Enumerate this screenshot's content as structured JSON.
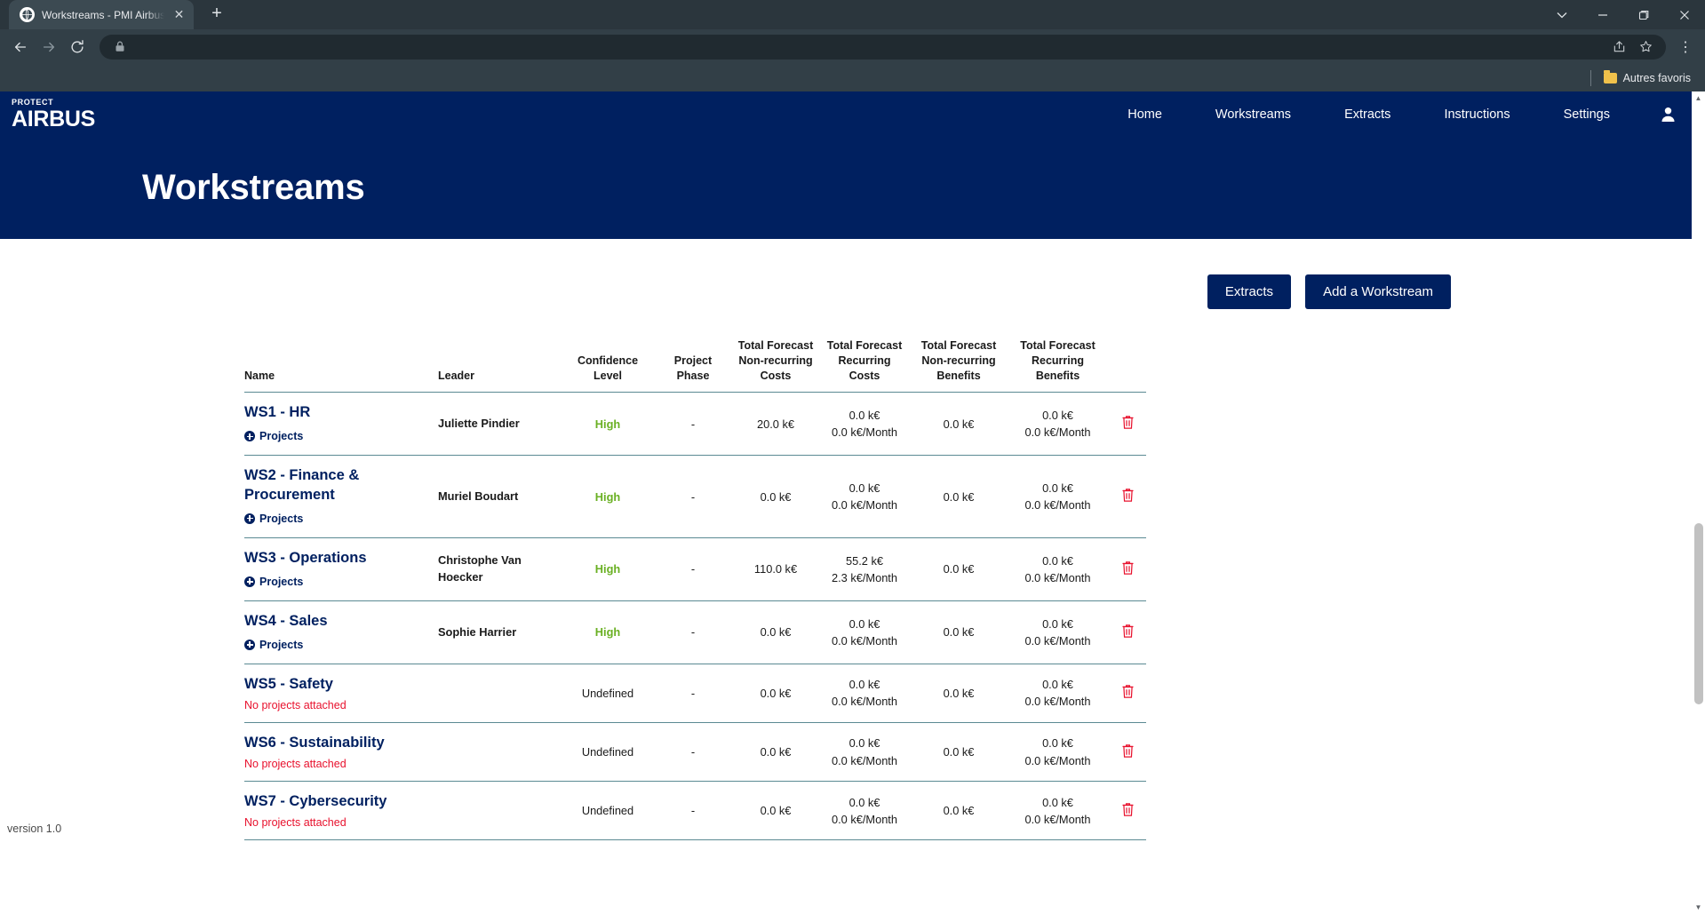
{
  "browser": {
    "tab": {
      "title": "Workstreams - PMI Airbus Protect",
      "favicon": "globe-icon",
      "close": "✕"
    },
    "new_tab_label": "+",
    "window_controls": {
      "minimize": "—",
      "maximize": "❐",
      "close": "✕",
      "tab_search": "⌄"
    },
    "nav": {
      "back": "←",
      "forward": "→",
      "reload": "⟳"
    },
    "omnibox": {
      "value": "",
      "placeholder": "",
      "lock_icon": "lock-icon",
      "share_icon": "share-icon",
      "star_icon": "star-icon"
    },
    "menu": "⋮",
    "bookmarks": [
      {
        "label": "Autres favoris",
        "icon": "folder-icon"
      }
    ]
  },
  "app": {
    "logo": {
      "top": "PROTECT",
      "bottom": "AIRBUS"
    },
    "nav_links": [
      {
        "label": "Home"
      },
      {
        "label": "Workstreams"
      },
      {
        "label": "Extracts"
      },
      {
        "label": "Instructions"
      },
      {
        "label": "Settings"
      }
    ],
    "user_icon": "user-avatar-icon",
    "page_title": "Workstreams",
    "buttons": {
      "extracts": "Extracts",
      "add_workstream": "Add a Workstream"
    },
    "footer": {
      "version": "version 1.0"
    },
    "colors": {
      "brand_navy": "#002060",
      "confidence_high": "#6ab023",
      "danger_red": "#e8112d",
      "table_border": "#5b8a93"
    }
  },
  "table": {
    "headers": {
      "name": "Name",
      "leader": "Leader",
      "confidence_level": "Confidence\nLevel",
      "confidence_level_l1": "Confidence",
      "confidence_level_l2": "Level",
      "project_phase_l1": "Project",
      "project_phase_l2": "Phase",
      "tf_nrc_l1": "Total Forecast",
      "tf_nrc_l2": "Non-recurring",
      "tf_nrc_l3": "Costs",
      "tf_rc_l1": "Total Forecast",
      "tf_rc_l2": "Recurring",
      "tf_rc_l3": "Costs",
      "tf_nrb_l1": "Total Forecast",
      "tf_nrb_l2": "Non-recurring",
      "tf_nrb_l3": "Benefits",
      "tf_rb_l1": "Total Forecast",
      "tf_rb_l2": "Recurring",
      "tf_rb_l3": "Benefits"
    },
    "projects_label": "Projects",
    "no_projects_label": "No projects attached",
    "delete_icon": "trash-icon",
    "rows": [
      {
        "name": "WS1 - HR",
        "has_projects": true,
        "leader": "Juliette Pindier",
        "confidence": "High",
        "confidence_state": "high",
        "phase": "-",
        "nrc": "20.0 k€",
        "nrc_sub": "",
        "rc": "0.0 k€",
        "rc_sub": "0.0 k€/Month",
        "nrb": "0.0 k€",
        "nrb_sub": "",
        "rb": "0.0 k€",
        "rb_sub": "0.0 k€/Month"
      },
      {
        "name": "WS2 - Finance & Procurement",
        "has_projects": true,
        "leader": "Muriel Boudart",
        "confidence": "High",
        "confidence_state": "high",
        "phase": "-",
        "nrc": "0.0 k€",
        "nrc_sub": "",
        "rc": "0.0 k€",
        "rc_sub": "0.0 k€/Month",
        "nrb": "0.0 k€",
        "nrb_sub": "",
        "rb": "0.0 k€",
        "rb_sub": "0.0 k€/Month"
      },
      {
        "name": "WS3 - Operations",
        "has_projects": true,
        "leader": "Christophe Van Hoecker",
        "confidence": "High",
        "confidence_state": "high",
        "phase": "-",
        "nrc": "110.0 k€",
        "nrc_sub": "",
        "rc": "55.2 k€",
        "rc_sub": "2.3 k€/Month",
        "nrb": "0.0 k€",
        "nrb_sub": "",
        "rb": "0.0 k€",
        "rb_sub": "0.0 k€/Month"
      },
      {
        "name": "WS4 - Sales",
        "has_projects": true,
        "leader": "Sophie Harrier",
        "confidence": "High",
        "confidence_state": "high",
        "phase": "-",
        "nrc": "0.0 k€",
        "nrc_sub": "",
        "rc": "0.0 k€",
        "rc_sub": "0.0 k€/Month",
        "nrb": "0.0 k€",
        "nrb_sub": "",
        "rb": "0.0 k€",
        "rb_sub": "0.0 k€/Month"
      },
      {
        "name": "WS5 - Safety",
        "has_projects": false,
        "leader": "",
        "confidence": "Undefined",
        "confidence_state": "undefined",
        "phase": "-",
        "nrc": "0.0 k€",
        "nrc_sub": "",
        "rc": "0.0 k€",
        "rc_sub": "0.0 k€/Month",
        "nrb": "0.0 k€",
        "nrb_sub": "",
        "rb": "0.0 k€",
        "rb_sub": "0.0 k€/Month"
      },
      {
        "name": "WS6 - Sustainability",
        "has_projects": false,
        "leader": "",
        "confidence": "Undefined",
        "confidence_state": "undefined",
        "phase": "-",
        "nrc": "0.0 k€",
        "nrc_sub": "",
        "rc": "0.0 k€",
        "rc_sub": "0.0 k€/Month",
        "nrb": "0.0 k€",
        "nrb_sub": "",
        "rb": "0.0 k€",
        "rb_sub": "0.0 k€/Month"
      },
      {
        "name": "WS7 - Cybersecurity",
        "has_projects": false,
        "leader": "",
        "confidence": "Undefined",
        "confidence_state": "undefined",
        "phase": "-",
        "nrc": "0.0 k€",
        "nrc_sub": "",
        "rc": "0.0 k€",
        "rc_sub": "0.0 k€/Month",
        "nrb": "0.0 k€",
        "nrb_sub": "",
        "rb": "0.0 k€",
        "rb_sub": "0.0 k€/Month"
      }
    ]
  }
}
